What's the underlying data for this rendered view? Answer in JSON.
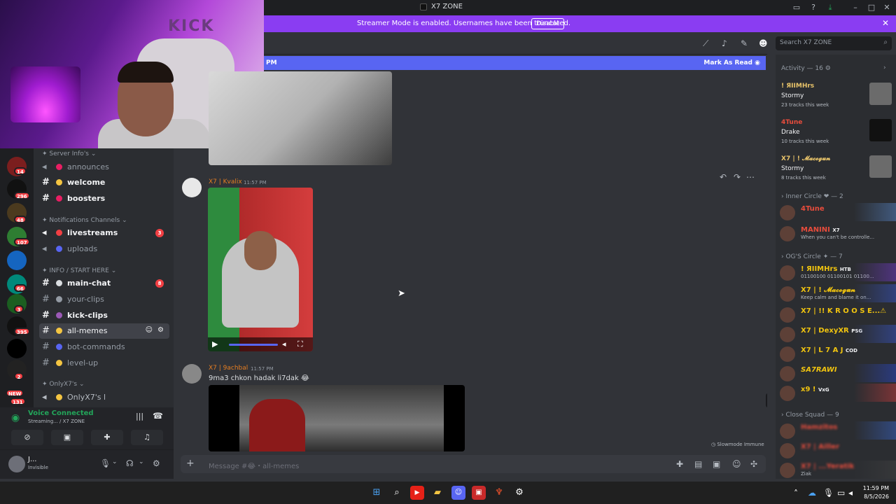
{
  "window": {
    "title": "X7 ZONE"
  },
  "banner": {
    "text": "Streamer Mode is enabled. Usernames have been truncated.",
    "button": "Disable"
  },
  "header": {
    "search_placeholder": "Search X7 ZONE"
  },
  "unread_bar": {
    "time": "PM",
    "action": "Mark As Read"
  },
  "guilds": [
    {
      "badge": "14"
    },
    {
      "badge": "296"
    },
    {
      "badge": "48"
    },
    {
      "badge": "107"
    },
    {
      "badge": "66"
    },
    {
      "badge": "3"
    },
    {
      "badge": "395"
    },
    {
      "badge": ""
    },
    {
      "badge": "2"
    },
    {
      "badge": "131",
      "new": "NEW"
    }
  ],
  "channels": {
    "categories": [
      "Server Info's",
      "Notifications Channels",
      "INFO / START HERE",
      "OnlyX7's"
    ],
    "items": [
      {
        "name": "announces",
        "badge": ""
      },
      {
        "name": "welcome",
        "badge": ""
      },
      {
        "name": "boosters",
        "badge": ""
      },
      {
        "name": "livestreams",
        "badge": "3"
      },
      {
        "name": "uploads",
        "badge": ""
      },
      {
        "name": "main-chat",
        "badge": "8"
      },
      {
        "name": "your-clips",
        "badge": ""
      },
      {
        "name": "kick-clips",
        "badge": ""
      },
      {
        "name": "all-memes",
        "badge": ""
      },
      {
        "name": "bot-commands",
        "badge": ""
      },
      {
        "name": "level-up",
        "badge": ""
      },
      {
        "name": "OnlyX7's l",
        "badge": ""
      }
    ]
  },
  "voice": {
    "status": "Voice Connected",
    "sub": "Streaming... / X7 ZONE"
  },
  "user": {
    "name": "J...",
    "status": "Invisible"
  },
  "messages": [
    {
      "author": "X7 | Kvalix",
      "time": "11:57 PM"
    },
    {
      "author": "X7 | 9achbal",
      "time": "11:57 PM",
      "text": "9ma3 chkon hadak li7dak 😂"
    }
  ],
  "composer": {
    "placeholder": "Message #😂・all-memes",
    "slowmode": "Slowmode Immune"
  },
  "members": {
    "activity_header": "Activity — 16",
    "activities": [
      {
        "name": "! ЯIIMHrs",
        "track": "Stormy",
        "sub": "23 tracks this week",
        "color": "#e9c46a"
      },
      {
        "name": "4Tune",
        "track": "Drake",
        "sub": "10 tracks this week",
        "color": "#e74c3c"
      },
      {
        "name": "X7 | ! 𝓜𝓪𝓬𝓸𝓰𝓾𝓷",
        "track": "Stormy",
        "sub": "8 tracks this week",
        "color": "#e9c46a"
      }
    ],
    "sections": [
      {
        "title": "Inner Circle",
        "count": "2",
        "members": [
          {
            "name": "4Tune",
            "status": "",
            "color": "#e74c3c"
          },
          {
            "name": "MANINI",
            "tag": "X7",
            "status": "When you can't be controlle...",
            "color": "#e74c3c"
          }
        ]
      },
      {
        "title": "OG'S Circle",
        "count": "7",
        "members": [
          {
            "name": "! ЯIIMHrs",
            "tag": "HTB",
            "status": "01100100 01100101 01100...",
            "color": "#f1c40f"
          },
          {
            "name": "X7 | ! 𝓜𝓪𝓬𝓸𝓰𝓾𝓷",
            "status": "Keep calm and blame it on...",
            "color": "#f1c40f"
          },
          {
            "name": "X7 | !! K R O O S E...⚠",
            "status": "",
            "color": "#f1c40f"
          },
          {
            "name": "X7 | DexyXR",
            "tag": "PSG",
            "status": "",
            "color": "#f1c40f"
          },
          {
            "name": "X7 | L 7 A J",
            "tag": "COD",
            "status": "",
            "color": "#f1c40f"
          },
          {
            "name": "SA7RAWI",
            "status": "",
            "color": "#f1c40f"
          },
          {
            "name": "x9 !",
            "tag": "VxG",
            "status": "",
            "color": "#f1c40f"
          }
        ]
      },
      {
        "title": "Close Squad",
        "count": "9",
        "members": [
          {
            "name": "Hamzitos",
            "status": "",
            "color": "#e74c3c"
          },
          {
            "name": "X7 | Ailler",
            "status": "",
            "color": "#e74c3c"
          },
          {
            "name": "X7 | ...Yeratik",
            "status": "Ziak",
            "color": "#e74c3c"
          }
        ]
      }
    ]
  },
  "taskbar": {
    "time": "11:59 PM",
    "date": "8/5/2026"
  }
}
